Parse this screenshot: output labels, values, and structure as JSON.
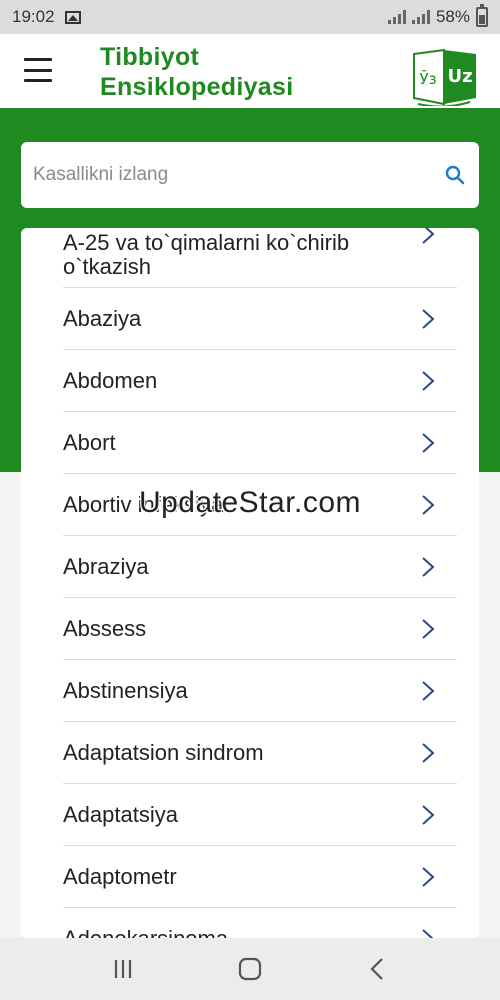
{
  "status_bar": {
    "time": "19:02",
    "battery": "58%"
  },
  "header": {
    "title_line1": "Tibbiyot",
    "title_line2": "Ensiklopediyasi",
    "logo_left": "Ўз",
    "logo_right": "Uz"
  },
  "search": {
    "placeholder": "Kasallikni izlang",
    "value": ""
  },
  "list": {
    "items": [
      {
        "label": "A-25 va to`qimalarni ko`chirib o`tkazish"
      },
      {
        "label": "Abaziya"
      },
      {
        "label": "Abdomen"
      },
      {
        "label": "Abort"
      },
      {
        "label": "Abortiv infeksiya"
      },
      {
        "label": "Abraziya"
      },
      {
        "label": "Abssess"
      },
      {
        "label": "Abstinensiya"
      },
      {
        "label": "Adaptatsion sindrom"
      },
      {
        "label": "Adaptatsiya"
      },
      {
        "label": "Adaptometr"
      },
      {
        "label": "Adenokarsinoma"
      }
    ]
  },
  "watermark": "UpdateStar.com",
  "colors": {
    "brand_green": "#1f8a1f",
    "chevron": "#2a4a8a"
  }
}
